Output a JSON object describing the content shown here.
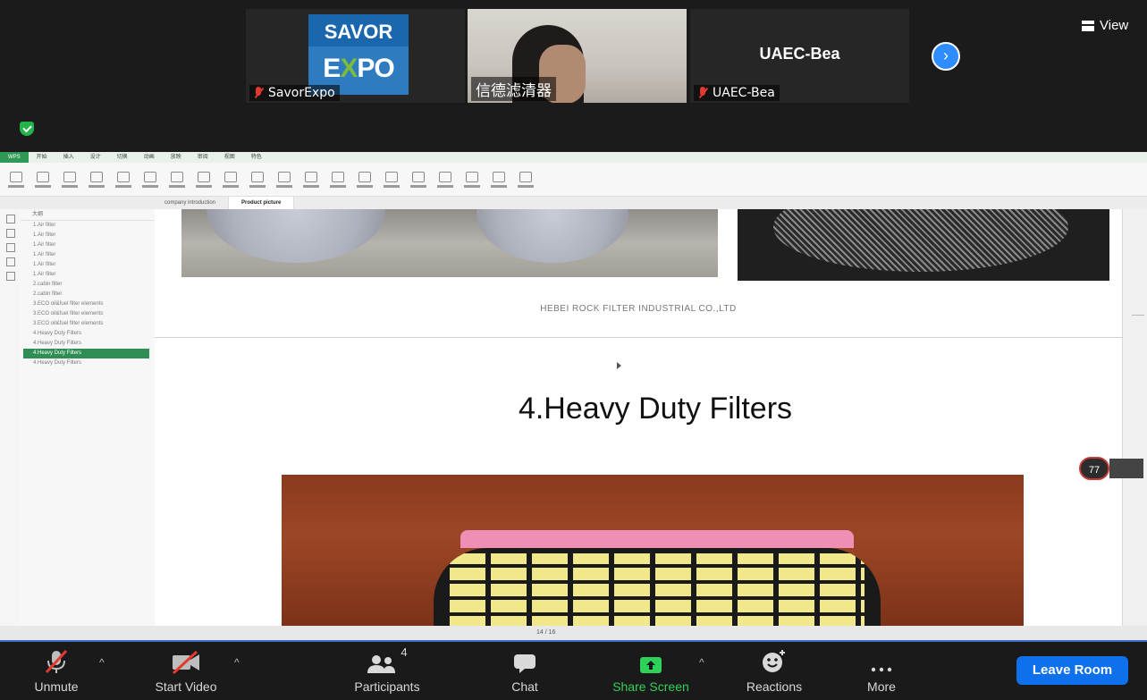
{
  "participants": {
    "tiles": [
      {
        "name": "SavorExpo",
        "logo_top": "SAVOR",
        "logo_bottom_e": "E",
        "logo_bottom_x": "X",
        "logo_bottom_po": "PO"
      },
      {
        "name": "信德滤清器"
      },
      {
        "name": "UAEC-Bea",
        "title": "UAEC-Bea"
      }
    ],
    "next_label": "›",
    "view_label": "View"
  },
  "presentation": {
    "ribbon_tabs": [
      "开始",
      "插入",
      "设计",
      "切换",
      "动画",
      "放映",
      "审阅",
      "视图",
      "特色"
    ],
    "doc_tabs": [
      "company introduction",
      "Product picture"
    ],
    "outline_header": "大纲",
    "outline_items": [
      "1.Air filter",
      "1.Air filter",
      "1.Air filter",
      "1.Air filter",
      "1.Air filter",
      "1.Air filter",
      "2.cabin filter",
      "2.cabin filter",
      "3.ECO oil&fuel filter elements",
      "3.ECO oil&fuel filter elements",
      "3.ECO oil&fuel filter elements",
      "4.Heavy Duty Filters",
      "4.Heavy Duty Filters",
      "4.Heavy Duty Filters",
      "4.Heavy Duty Filters"
    ],
    "selected_index": 13,
    "company": "HEBEI ROCK FILTER INDUSTRIAL CO.,LTD",
    "slide_title": "4.Heavy Duty Filters",
    "page_info": "14 / 16",
    "zoom_badge": "77"
  },
  "toolbar": {
    "unmute": "Unmute",
    "start_video": "Start Video",
    "participants": "Participants",
    "participants_count": "4",
    "chat": "Chat",
    "share_screen": "Share Screen",
    "reactions": "Reactions",
    "more": "More",
    "leave": "Leave Room"
  },
  "colors": {
    "share_green": "#2fd259",
    "leave_blue": "#0e71eb",
    "muted_red": "#e4382f",
    "wps_green": "#2f9955"
  }
}
